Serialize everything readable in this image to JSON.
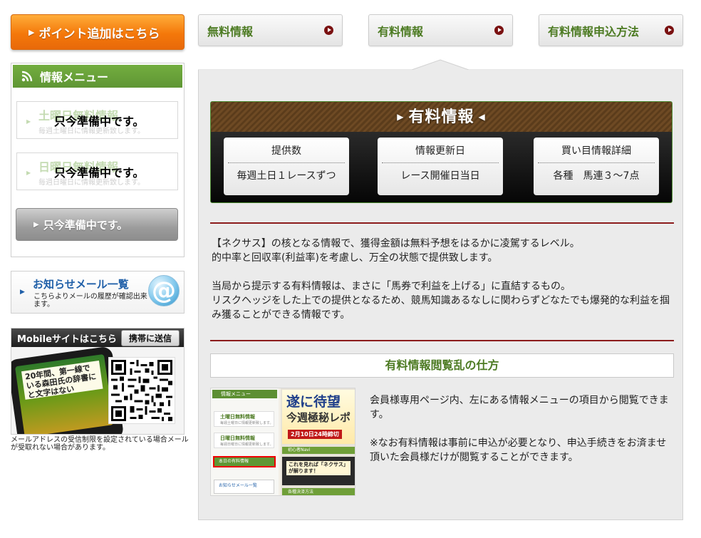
{
  "sidebar": {
    "point_button": "ポイント追加はこちら",
    "info_menu": {
      "title": "情報メニュー",
      "items": [
        {
          "ghost_title": "土曜日無料情報",
          "ghost_sub": "毎週土曜日に情報更新致します。",
          "overlay": "只今準備中です。"
        },
        {
          "ghost_title": "日曜日無料情報",
          "ghost_sub": "毎週日曜日に情報更新致します。",
          "overlay": "只今準備中です。"
        }
      ],
      "disabled_button": "只今準備中です。"
    },
    "mail_banner": {
      "title": "お知らせメール一覧",
      "desc": "こちらよりメールの履歴が確認出来ます。",
      "icon": "at-icon"
    },
    "mobile": {
      "title": "Mobileサイトはこちら",
      "send_button": "携帯に送信",
      "phone_text": "20年間、第一線で\nいる森田氏の辞書に\nと文字はない",
      "note": "メールアドレスの受信制限を設定されている場合メールが受取れない場合があります。"
    }
  },
  "tabs": [
    {
      "label": "無料情報"
    },
    {
      "label": "有料情報"
    },
    {
      "label": "有料情報申込方法"
    }
  ],
  "paid_card": {
    "title": "有料情報",
    "boxes": [
      {
        "header": "提供数",
        "value": "毎週土日１レースずつ"
      },
      {
        "header": "情報更新日",
        "value": "レース開催日当日"
      },
      {
        "header": "買い目情報詳細",
        "value": "各種　馬連３～7点"
      }
    ]
  },
  "description": {
    "para1_line1": "【ネクサス】の核となる情報で、獲得金額は無料予想をはるかに凌駕するレベル。",
    "para1_line2": "的中率と回収率(利益率)を考慮し、万全の状態で提供致します。",
    "para2_line1": "当局から提示する有料情報は、まさに「馬券で利益を上げる」に直結するもの。",
    "para2_line2": "リスクヘッジをした上での提供となるため、競馬知識あるなしに関わらずどなたでも爆発的な利益を掴み獲ることができる情報です。"
  },
  "howto": {
    "title": "有料情報閲覧乱の仕方",
    "text1": "会員様専用ページ内、左にある情報メニューの項目から閲覧できます。",
    "text2": "※なお有料情報は事前に申込が必要となり、申込手続きをお済ませ頂いた会員様だけが閲覧することができます。",
    "screenshot": {
      "menu_title": "情報メニュー",
      "item1": "土曜日無料情報",
      "item1_sub": "毎週土曜日に情報更新致します。",
      "item2": "日曜日無料情報",
      "item2_sub": "毎週日曜日に情報更新致します。",
      "today_button": "本日の有料情報",
      "mail": "お知らせメール一覧",
      "banner1": "遂に待望",
      "banner2": "今週極秘レポ",
      "banner3": "2月10日24時締切",
      "green_bar": "初心者Navi",
      "dark_text": "これを見れば「ネクサス」\nが解ります！",
      "footer": "各種決済方法"
    }
  },
  "colors": {
    "accent_orange": "#f4780a",
    "menu_green": "#5f9634",
    "tab_text_green": "#4d7b23",
    "divider_red": "#8c1c1c",
    "link_blue": "#1f5fa8"
  }
}
